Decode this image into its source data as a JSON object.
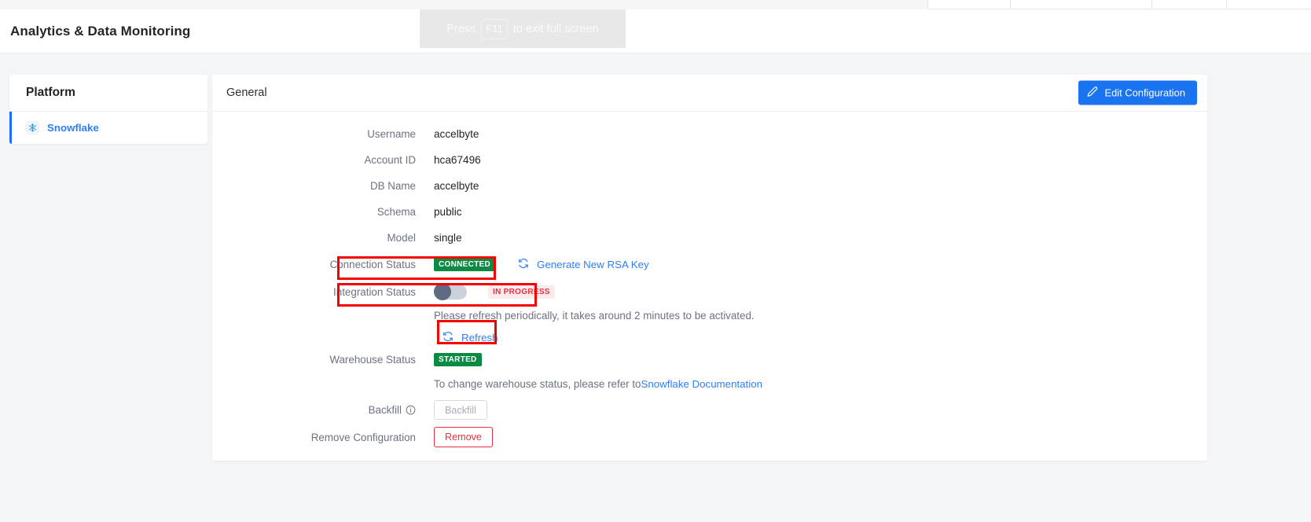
{
  "header": {
    "title": "Analytics & Data Monitoring",
    "fullscreen_hint": {
      "pre": "Press",
      "key": "F11",
      "post": "to exit full screen"
    }
  },
  "sidebar": {
    "title": "Platform",
    "items": [
      {
        "label": "Snowflake",
        "icon": "snowflake-icon",
        "active": true
      }
    ]
  },
  "card": {
    "title": "General",
    "edit_button": {
      "label": "Edit Configuration",
      "icon": "pencil-icon"
    }
  },
  "fields": {
    "username": {
      "label": "Username",
      "value": "accelbyte"
    },
    "account_id": {
      "label": "Account ID",
      "value": "hca67496"
    },
    "db_name": {
      "label": "DB Name",
      "value": "accelbyte"
    },
    "schema": {
      "label": "Schema",
      "value": "public"
    },
    "model": {
      "label": "Model",
      "value": "single"
    },
    "connection_status": {
      "label": "Connection Status",
      "badge": "CONNECTED",
      "link": "Generate New RSA Key",
      "link_icon": "refresh-icon"
    },
    "integration_status": {
      "label": "Integration Status",
      "badge": "IN PROGRESS",
      "toggle_state": "off",
      "helper": "Please refresh periodically, it takes around 2 minutes to be activated.",
      "refresh_link": "Refresh",
      "refresh_icon": "refresh-icon"
    },
    "warehouse_status": {
      "label": "Warehouse Status",
      "badge": "STARTED",
      "helper_prefix": "To change warehouse status, please refer to ",
      "helper_link": "Snowflake Documentation"
    },
    "backfill": {
      "label": "Backfill",
      "info_icon": "info-icon",
      "button_label": "Backfill",
      "disabled": true
    },
    "remove_configuration": {
      "label": "Remove Configuration",
      "button_label": "Remove"
    }
  },
  "colors": {
    "accent_blue": "#1a73f0",
    "link_blue": "#2d7ff9",
    "badge_green": "#0b8a43",
    "badge_pink_bg": "#fdeaec",
    "badge_pink_text": "#e8303f",
    "danger_red": "#e8303f",
    "highlight_red": "#f50000",
    "page_bg": "#f4f5f7"
  }
}
